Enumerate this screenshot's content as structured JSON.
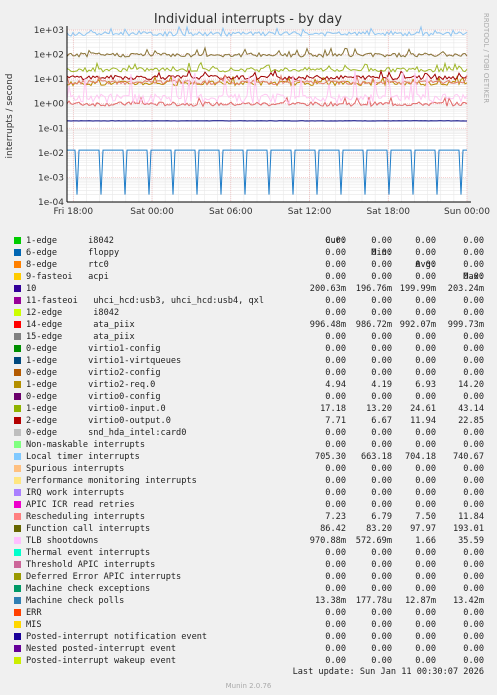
{
  "chart_data": {
    "type": "line",
    "title": "Individual interrupts - by day",
    "ylabel": "interrupts / second",
    "side_label": "RRDTOOL / TOBI OETIKER",
    "yscale": "log",
    "ylim": [
      0.0001,
      1000
    ],
    "ytick_labels": [
      "1e+03",
      "1e+02",
      "1e+01",
      "1e+00",
      "1e-01",
      "1e-02",
      "1e-03",
      "1e-04"
    ],
    "xtick_labels": [
      "Fri 18:00",
      "Sat 00:00",
      "Sat 06:00",
      "Sat 12:00",
      "Sat 18:00",
      "Sun 00:00"
    ],
    "grid": true,
    "series": [
      {
        "name": "10",
        "typical": 0.2,
        "color": "#00007f"
      },
      {
        "name": "14-edge ata_piix",
        "typical": 0.99,
        "color": "#e16a6a"
      },
      {
        "name": "1-edge virtio2-req.0",
        "typical": 6.9,
        "color": "#bb8800"
      },
      {
        "name": "1-edge virtio0-input.0",
        "typical": 24.6,
        "color": "#9fb628"
      },
      {
        "name": "2-edge virtio0-output.0",
        "typical": 11.9,
        "color": "#9f0000"
      },
      {
        "name": "Local timer interrupts",
        "typical": 704,
        "color": "#8fc5f2"
      },
      {
        "name": "Rescheduling interrupts",
        "typical": 7.5,
        "color": "#e37e6c"
      },
      {
        "name": "Function call interrupts",
        "typical": 98,
        "color": "#887438"
      },
      {
        "name": "TLB shootdowns",
        "typical": 1.66,
        "color": "#ffc8f2"
      },
      {
        "name": "Machine check polls",
        "typical": 0.0129,
        "color": "#1f7dc8"
      }
    ]
  },
  "legend": {
    "headers": {
      "cur": "Cur:",
      "min": "Min:",
      "avg": "Avg:",
      "max": "Max:"
    },
    "rows": [
      {
        "label": "1-edge      i8042",
        "color": "#00cc00",
        "cur": "0.00",
        "min": "0.00",
        "avg": "0.00",
        "max": "0.00"
      },
      {
        "label": "6-edge      floppy",
        "color": "#0066b3",
        "cur": "0.00",
        "min": "0.00",
        "avg": "0.00",
        "max": "0.00"
      },
      {
        "label": "8-edge      rtc0",
        "color": "#ff8000",
        "cur": "0.00",
        "min": "0.00",
        "avg": "0.00",
        "max": "0.00"
      },
      {
        "label": "9-fasteoi   acpi",
        "color": "#ffcc00",
        "cur": "0.00",
        "min": "0.00",
        "avg": "0.00",
        "max": "0.00"
      },
      {
        "label": "10",
        "color": "#330099",
        "cur": "200.63m",
        "min": "196.76m",
        "avg": "199.99m",
        "max": "203.24m"
      },
      {
        "label": "11-fasteoi   uhci_hcd:usb3, uhci_hcd:usb4, qxl",
        "color": "#990099",
        "cur": "0.00",
        "min": "0.00",
        "avg": "0.00",
        "max": "0.00"
      },
      {
        "label": "12-edge      i8042",
        "color": "#ccff00",
        "cur": "0.00",
        "min": "0.00",
        "avg": "0.00",
        "max": "0.00"
      },
      {
        "label": "14-edge      ata_piix",
        "color": "#ff0000",
        "cur": "996.48m",
        "min": "986.72m",
        "avg": "992.07m",
        "max": "999.73m"
      },
      {
        "label": "15-edge      ata_piix",
        "color": "#808080",
        "cur": "0.00",
        "min": "0.00",
        "avg": "0.00",
        "max": "0.00"
      },
      {
        "label": "0-edge      virtio1-config",
        "color": "#008f00",
        "cur": "0.00",
        "min": "0.00",
        "avg": "0.00",
        "max": "0.00"
      },
      {
        "label": "1-edge      virtio1-virtqueues",
        "color": "#00487d",
        "cur": "0.00",
        "min": "0.00",
        "avg": "0.00",
        "max": "0.00"
      },
      {
        "label": "0-edge      virtio2-config",
        "color": "#b35a00",
        "cur": "0.00",
        "min": "0.00",
        "avg": "0.00",
        "max": "0.00"
      },
      {
        "label": "1-edge      virtio2-req.0",
        "color": "#b38f00",
        "cur": "4.94",
        "min": "4.19",
        "avg": "6.93",
        "max": "14.20"
      },
      {
        "label": "0-edge      virtio0-config",
        "color": "#6b006b",
        "cur": "0.00",
        "min": "0.00",
        "avg": "0.00",
        "max": "0.00"
      },
      {
        "label": "1-edge      virtio0-input.0",
        "color": "#8fb300",
        "cur": "17.18",
        "min": "13.20",
        "avg": "24.61",
        "max": "43.14"
      },
      {
        "label": "2-edge      virtio0-output.0",
        "color": "#b30000",
        "cur": "7.71",
        "min": "6.67",
        "avg": "11.94",
        "max": "22.85"
      },
      {
        "label": "0-edge      snd_hda_intel:card0",
        "color": "#bebebe",
        "cur": "0.00",
        "min": "0.00",
        "avg": "0.00",
        "max": "0.00"
      },
      {
        "label": "Non-maskable interrupts",
        "color": "#80ff80",
        "cur": "0.00",
        "min": "0.00",
        "avg": "0.00",
        "max": "0.00"
      },
      {
        "label": "Local timer interrupts",
        "color": "#80c9ff",
        "cur": "705.30",
        "min": "663.18",
        "avg": "704.18",
        "max": "740.67"
      },
      {
        "label": "Spurious interrupts",
        "color": "#ffc080",
        "cur": "0.00",
        "min": "0.00",
        "avg": "0.00",
        "max": "0.00"
      },
      {
        "label": "Performance monitoring interrupts",
        "color": "#ffe680",
        "cur": "0.00",
        "min": "0.00",
        "avg": "0.00",
        "max": "0.00"
      },
      {
        "label": "IRQ work interrupts",
        "color": "#aa80ff",
        "cur": "0.00",
        "min": "0.00",
        "avg": "0.00",
        "max": "0.00"
      },
      {
        "label": "APIC ICR read retries",
        "color": "#ee00cc",
        "cur": "0.00",
        "min": "0.00",
        "avg": "0.00",
        "max": "0.00"
      },
      {
        "label": "Rescheduling interrupts",
        "color": "#ff8080",
        "cur": "7.23",
        "min": "6.79",
        "avg": "7.50",
        "max": "11.84"
      },
      {
        "label": "Function call interrupts",
        "color": "#666600",
        "cur": "86.42",
        "min": "83.20",
        "avg": "97.97",
        "max": "193.01"
      },
      {
        "label": "TLB shootdowns",
        "color": "#ffbfff",
        "cur": "970.88m",
        "min": "572.69m",
        "avg": "1.66",
        "max": "35.59"
      },
      {
        "label": "Thermal event interrupts",
        "color": "#00ffcc",
        "cur": "0.00",
        "min": "0.00",
        "avg": "0.00",
        "max": "0.00"
      },
      {
        "label": "Threshold APIC interrupts",
        "color": "#cc6699",
        "cur": "0.00",
        "min": "0.00",
        "avg": "0.00",
        "max": "0.00"
      },
      {
        "label": "Deferred Error APIC interrupts",
        "color": "#999900",
        "cur": "0.00",
        "min": "0.00",
        "avg": "0.00",
        "max": "0.00"
      },
      {
        "label": "Machine check exceptions",
        "color": "#009966",
        "cur": "0.00",
        "min": "0.00",
        "avg": "0.00",
        "max": "0.00"
      },
      {
        "label": "Machine check polls",
        "color": "#2f7fb3",
        "cur": "13.38m",
        "min": "177.78u",
        "avg": "12.87m",
        "max": "13.42m"
      },
      {
        "label": "ERR",
        "color": "#ff4000",
        "cur": "0.00",
        "min": "0.00",
        "avg": "0.00",
        "max": "0.00"
      },
      {
        "label": "MIS",
        "color": "#ffd700",
        "cur": "0.00",
        "min": "0.00",
        "avg": "0.00",
        "max": "0.00"
      },
      {
        "label": "Posted-interrupt notification event",
        "color": "#1a0099",
        "cur": "0.00",
        "min": "0.00",
        "avg": "0.00",
        "max": "0.00"
      },
      {
        "label": "Nested posted-interrupt event",
        "color": "#660099",
        "cur": "0.00",
        "min": "0.00",
        "avg": "0.00",
        "max": "0.00"
      },
      {
        "label": "Posted-interrupt wakeup event",
        "color": "#ccee00",
        "cur": "0.00",
        "min": "0.00",
        "avg": "0.00",
        "max": "0.00"
      }
    ]
  },
  "footer": {
    "last_update": "Last update: Sun Jan 11 00:30:07 2026",
    "munin_version": "Munin 2.0.76"
  }
}
